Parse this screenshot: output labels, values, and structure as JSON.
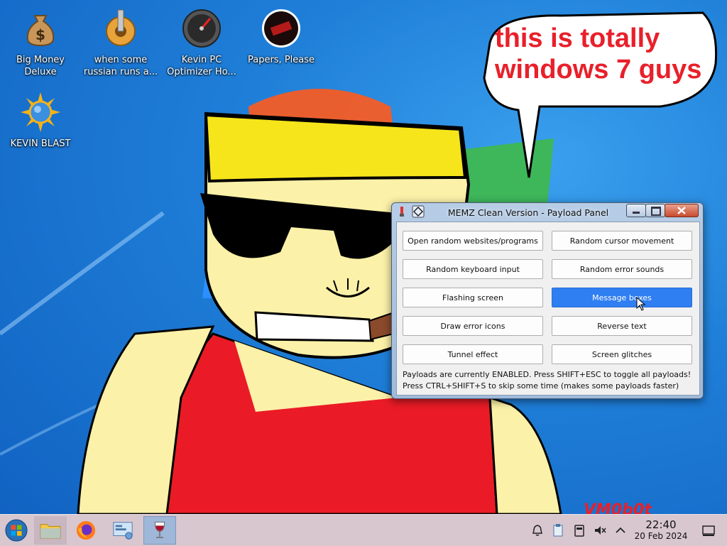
{
  "speech_bubble": {
    "line1": "this is totally",
    "line2": "windows 7 guys"
  },
  "watermark": "VM0b0t",
  "desktop_icons": [
    {
      "label": "Big Money Deluxe",
      "icon": "money-bag-icon"
    },
    {
      "label": "when some russian runs a...",
      "icon": "gear-icon"
    },
    {
      "label": "Kevin PC Optimizer Ho...",
      "icon": "gauge-icon"
    },
    {
      "label": "Papers, Please",
      "icon": "stamp-icon"
    },
    {
      "label": "KEVIN BLAST",
      "icon": "sun-globe-icon"
    }
  ],
  "window": {
    "title": "MEMZ Clean Version - Payload Panel",
    "buttons": [
      {
        "label": "Open random websites/programs"
      },
      {
        "label": "Random cursor movement"
      },
      {
        "label": "Random keyboard input"
      },
      {
        "label": "Random error sounds"
      },
      {
        "label": "Flashing screen"
      },
      {
        "label": "Message boxes",
        "state": "highlighted"
      },
      {
        "label": "Draw error icons"
      },
      {
        "label": "Reverse text"
      },
      {
        "label": "Tunnel effect"
      },
      {
        "label": "Screen glitches"
      }
    ],
    "status_line1": "Payloads are currently ENABLED. Press SHIFT+ESC to toggle all payloads!",
    "status_line2": "Press CTRL+SHIFT+S to skip some time (makes some payloads faster)"
  },
  "taskbar": {
    "apps": [
      "start-orb-icon",
      "file-manager-icon",
      "firefox-icon",
      "control-panel-icon",
      "wine-glass-icon"
    ],
    "clock_time": "22:40",
    "clock_date": "20 Feb 2024"
  },
  "colors": {
    "accent": "#2f7ef2",
    "bubble_text": "#e8202a",
    "taskbar": "#d8c7cf"
  }
}
